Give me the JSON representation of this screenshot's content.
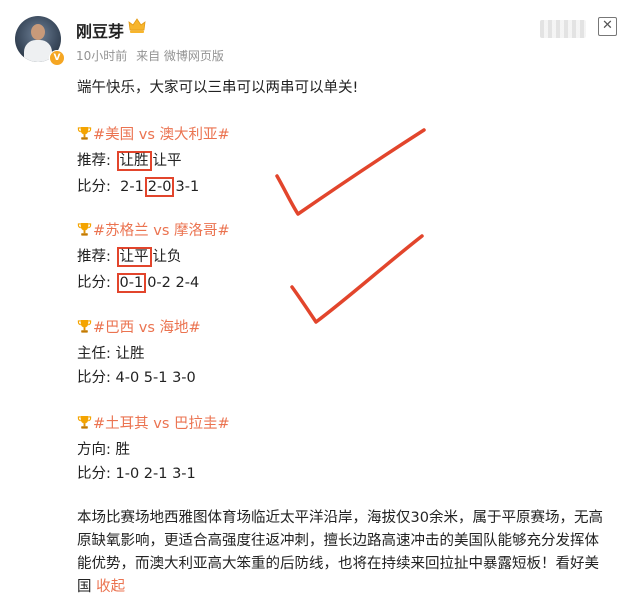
{
  "post": {
    "username": "刚豆芽",
    "time": "10小时前",
    "source": "来自 微博网页版",
    "intro": "端午快乐，大家可以三串可以两串可以单关!",
    "collapse_label": "收起"
  },
  "matches": [
    {
      "title": "#美国 vs 澳大利亚#",
      "rec_label": "推荐:",
      "rec_parts": [
        "让胜",
        "让平"
      ],
      "score_label": "比分:",
      "score_parts": [
        "2-1",
        "2-0",
        "3-1"
      ]
    },
    {
      "title": "#苏格兰 vs 摩洛哥#",
      "rec_label": "推荐:",
      "rec_parts": [
        "让平",
        "让负"
      ],
      "score_label": "比分:",
      "score_parts": [
        "0-1",
        "0-2",
        "2-4"
      ]
    },
    {
      "title": "#巴西 vs 海地#",
      "rec_label": "主任:",
      "rec_text": "让胜",
      "score_label": "比分:",
      "score_text": "4-0 5-1 3-0"
    },
    {
      "title": "#土耳其 vs 巴拉圭#",
      "rec_label": "方向:",
      "rec_text": "胜",
      "score_label": "比分:",
      "score_text": "1-0 2-1 3-1"
    }
  ],
  "analysis": {
    "text": "本场比赛场地西雅图体育场临近太平洋沿岸，海拔仅30余米，属于平原赛场，无高原缺氧影响，更适合高强度往返冲刺，擅长边路高速冲击的美国队能够充分发挥体能优势，而澳大利亚高大笨重的后防线，也将在持续来回拉扯中暴露短板！看好美国",
    "collapse_label": "收起"
  },
  "icons": {
    "trophy": "trophy-icon",
    "crown": "crown-icon",
    "verified": "verified-badge",
    "close": "close-icon"
  },
  "colors": {
    "topic": "#eb7350",
    "annotation": "#e2452c",
    "meta": "#939393",
    "verified": "#f5a623"
  }
}
